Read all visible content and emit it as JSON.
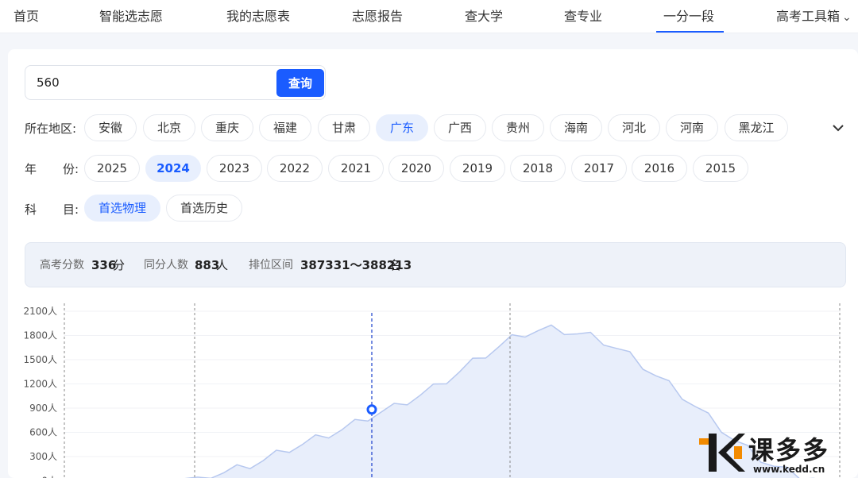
{
  "nav": {
    "items": [
      {
        "label": "首页"
      },
      {
        "label": "智能选志愿"
      },
      {
        "label": "我的志愿表"
      },
      {
        "label": "志愿报告"
      },
      {
        "label": "查大学"
      },
      {
        "label": "查专业"
      },
      {
        "label": "一分一段"
      },
      {
        "label": "高考工具箱"
      }
    ],
    "active": "一分一段",
    "accent": "#1a5cff"
  },
  "search": {
    "value": "560",
    "button_label": "查询"
  },
  "filters": {
    "region": {
      "label": "所在地区:",
      "options": [
        "安徽",
        "北京",
        "重庆",
        "福建",
        "甘肃",
        "广东",
        "广西",
        "贵州",
        "海南",
        "河北",
        "河南",
        "黑龙江"
      ],
      "selected": "广东"
    },
    "year": {
      "label_a": "年",
      "label_b": "份:",
      "options": [
        "2025",
        "2024",
        "2023",
        "2022",
        "2021",
        "2020",
        "2019",
        "2018",
        "2017",
        "2016",
        "2015"
      ],
      "selected": "2024"
    },
    "subject": {
      "label_a": "科",
      "label_b": "目:",
      "options": [
        "首选物理",
        "首选历史"
      ],
      "selected": "首选物理"
    },
    "expand_icon": "chevron-down-icon"
  },
  "result": {
    "score_label": "高考分数",
    "score_value": "336",
    "score_unit": "分",
    "count_label": "同分人数",
    "count_value": "883",
    "count_unit": "人",
    "rank_label": "排位区间",
    "rank_value": "387331～388213",
    "rank_unit": "名"
  },
  "chart_data": {
    "type": "area",
    "y_ticks": [
      "2100人",
      "1800人",
      "1500人",
      "1200人",
      "900人",
      "600人",
      "300人",
      "0人"
    ],
    "ylim": [
      0,
      2100
    ],
    "highlight_value": 883,
    "series": [
      {
        "values": [
          0,
          2,
          5,
          10,
          18,
          28,
          45,
          70,
          100,
          140,
          190,
          250,
          320,
          390,
          450,
          510,
          570,
          630,
          700,
          780,
          850,
          900,
          980,
          1060,
          1140,
          1240,
          1350,
          1460,
          1560,
          1660,
          1750,
          1820,
          1860,
          1870,
          1850,
          1820,
          1780,
          1720,
          1640,
          1540,
          1420,
          1300,
          1180,
          1050,
          920,
          780,
          640,
          500,
          380,
          270,
          180,
          110,
          60,
          30,
          10
        ]
      }
    ],
    "colors": {
      "fill": "#e8eefb",
      "line": "#b7c8ef",
      "marker": "#1a5cff"
    }
  },
  "logo": {
    "text": "课多多",
    "url": "www.kedd.cn"
  }
}
